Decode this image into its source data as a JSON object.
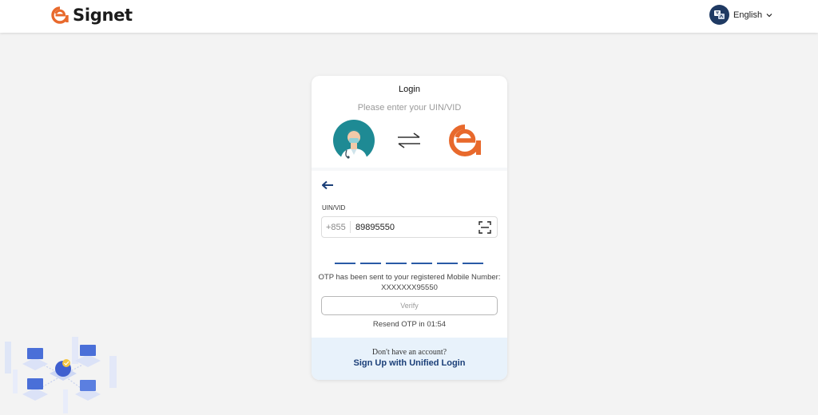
{
  "header": {
    "brand_name": "Signet",
    "language_label": "English",
    "icons": [
      "signet-logo-icon",
      "language-globe-icon",
      "chevron-down-icon"
    ]
  },
  "login_card": {
    "title": "Login",
    "subtitle": "Please enter your UIN/VID",
    "field_label": "UIN/VID",
    "country_code": "+855",
    "uin_value": "89895550",
    "otp_digits": [
      "",
      "",
      "",
      "",
      "",
      ""
    ],
    "otp_message_line1": "OTP has been sent to your registered Mobile Number:",
    "otp_message_line2": "XXXXXXX95550",
    "verify_label": "Verify",
    "resend_text": "Resend OTP in 01:54",
    "icons": [
      "doctor-avatar-icon",
      "swap-arrows-icon",
      "signet-logo-icon",
      "back-arrow-icon",
      "scan-icon"
    ]
  },
  "footer": {
    "question": "Don't have an account?",
    "signup_link": "Sign Up with Unified Login"
  },
  "colors": {
    "brand_orange": "#e8692c",
    "navy": "#1b3f78",
    "teal": "#1e8a94",
    "otp_underline": "#2a5aa6",
    "footer_bg": "#e8f2fb"
  }
}
